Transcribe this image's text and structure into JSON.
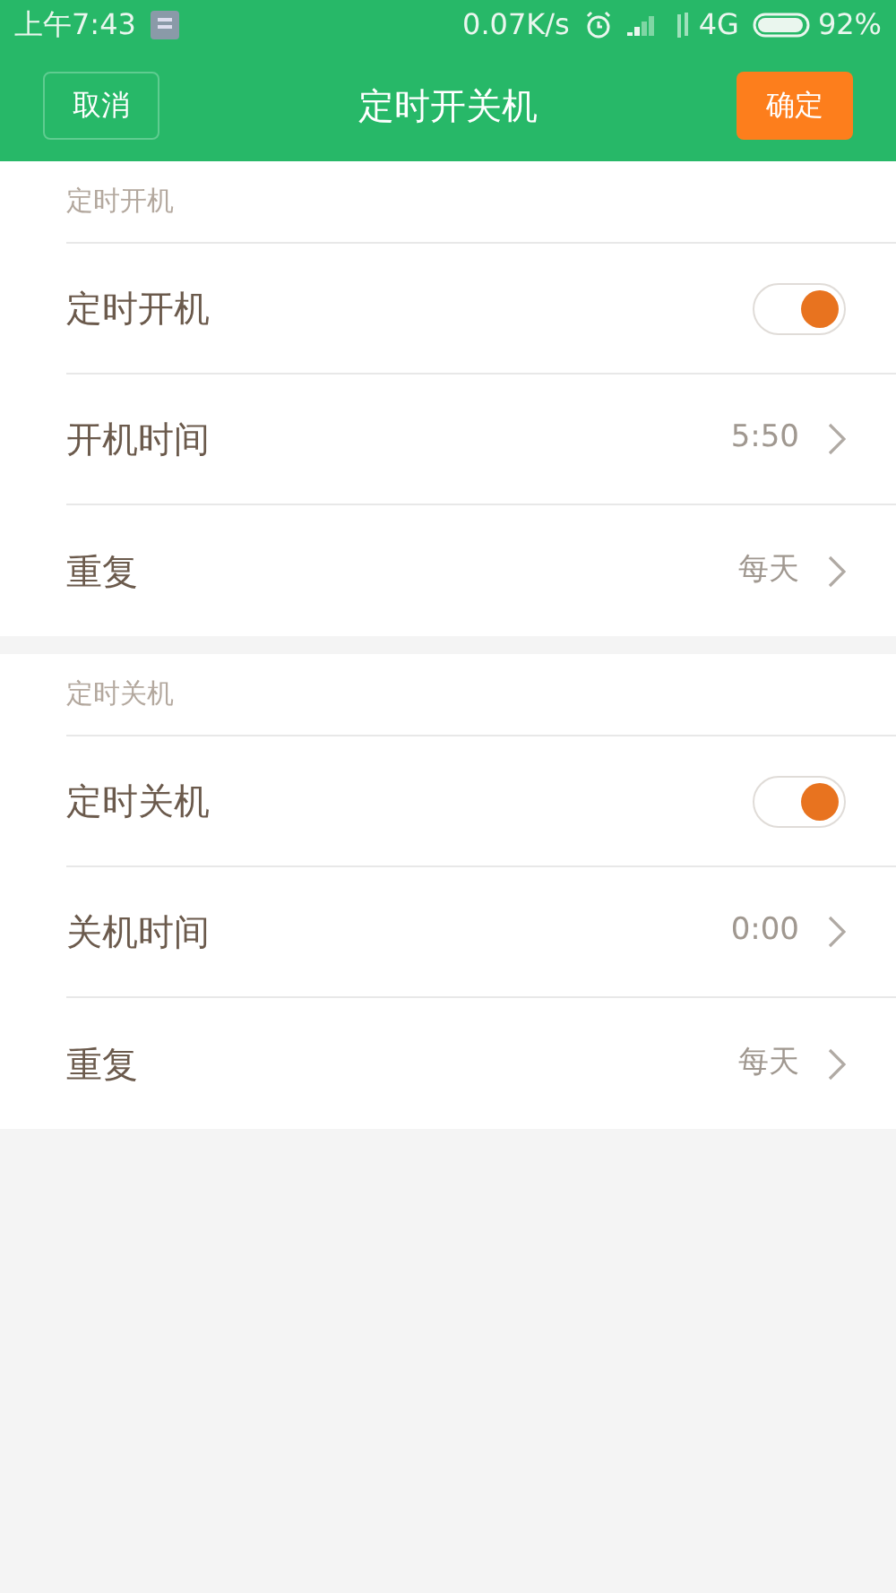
{
  "status_bar": {
    "time": "上午7:43",
    "speed": "0.07K/s",
    "network": "4G",
    "battery": "92%"
  },
  "header": {
    "cancel": "取消",
    "title": "定时开关机",
    "confirm": "确定"
  },
  "sections": [
    {
      "title": "定时开机",
      "rows": [
        {
          "kind": "toggle",
          "label": "定时开机",
          "on": true
        },
        {
          "kind": "value",
          "label": "开机时间",
          "value": "5:50"
        },
        {
          "kind": "value",
          "label": "重复",
          "value": "每天"
        }
      ]
    },
    {
      "title": "定时关机",
      "rows": [
        {
          "kind": "toggle",
          "label": "定时关机",
          "on": true
        },
        {
          "kind": "value",
          "label": "关机时间",
          "value": "0:00"
        },
        {
          "kind": "value",
          "label": "重复",
          "value": "每天"
        }
      ]
    }
  ]
}
